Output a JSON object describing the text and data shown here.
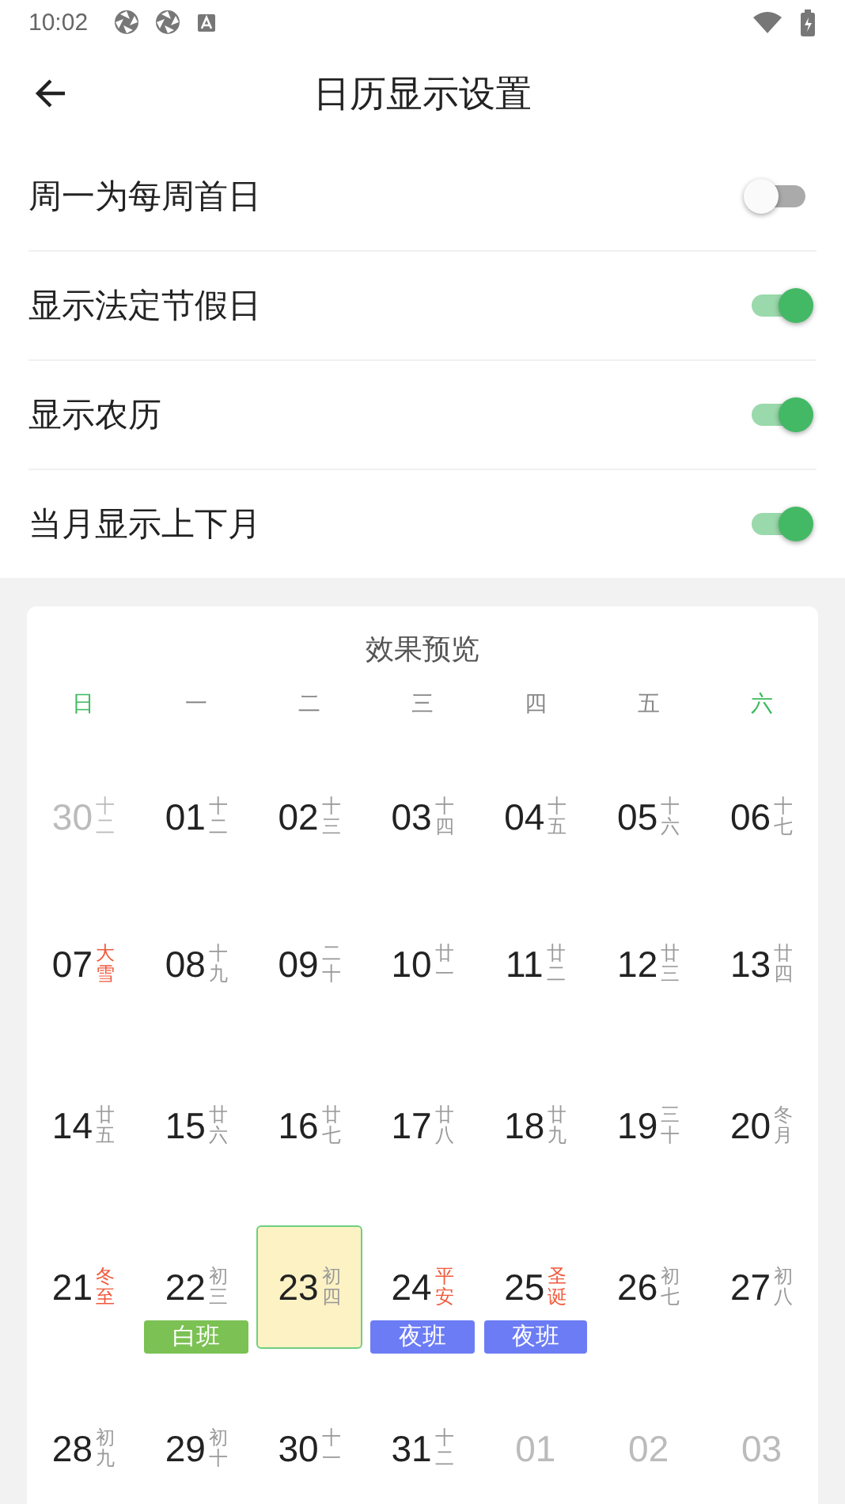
{
  "status_bar": {
    "time": "10:02"
  },
  "app_bar": {
    "title": "日历显示设置"
  },
  "settings": [
    {
      "label": "周一为每周首日",
      "on": false
    },
    {
      "label": "显示法定节假日",
      "on": true
    },
    {
      "label": "显示农历",
      "on": true
    },
    {
      "label": "当月显示上下月",
      "on": true
    }
  ],
  "preview": {
    "title": "效果预览",
    "weekdays": [
      {
        "label": "日",
        "weekend": true
      },
      {
        "label": "一",
        "weekend": false
      },
      {
        "label": "二",
        "weekend": false
      },
      {
        "label": "三",
        "weekend": false
      },
      {
        "label": "四",
        "weekend": false
      },
      {
        "label": "五",
        "weekend": false
      },
      {
        "label": "六",
        "weekend": true
      }
    ],
    "weeks": [
      [
        {
          "day": "30",
          "lunar": "十二",
          "other_month": true,
          "selected": false
        },
        {
          "day": "01",
          "lunar": "十二",
          "selected": false
        },
        {
          "day": "02",
          "lunar": "十三",
          "selected": false
        },
        {
          "day": "03",
          "lunar": "十四",
          "selected": false
        },
        {
          "day": "04",
          "lunar": "十五",
          "selected": false
        },
        {
          "day": "05",
          "lunar": "十六",
          "selected": false
        },
        {
          "day": "06",
          "lunar": "十七",
          "selected": false
        }
      ],
      [
        {
          "day": "07",
          "lunar": "大雪",
          "festival": true,
          "selected": false
        },
        {
          "day": "08",
          "lunar": "十九",
          "selected": false
        },
        {
          "day": "09",
          "lunar": "二十",
          "selected": false
        },
        {
          "day": "10",
          "lunar": "廿一",
          "selected": false
        },
        {
          "day": "11",
          "lunar": "廿二",
          "selected": false
        },
        {
          "day": "12",
          "lunar": "廿三",
          "selected": false
        },
        {
          "day": "13",
          "lunar": "廿四",
          "selected": false
        }
      ],
      [
        {
          "day": "14",
          "lunar": "廿五",
          "selected": false
        },
        {
          "day": "15",
          "lunar": "廿六",
          "selected": false
        },
        {
          "day": "16",
          "lunar": "廿七",
          "selected": false
        },
        {
          "day": "17",
          "lunar": "廿八",
          "selected": false
        },
        {
          "day": "18",
          "lunar": "廿九",
          "selected": false
        },
        {
          "day": "19",
          "lunar": "三十",
          "selected": false
        },
        {
          "day": "20",
          "lunar": "冬月",
          "selected": false
        }
      ],
      [
        {
          "day": "21",
          "lunar": "冬至",
          "festival": true,
          "selected": false
        },
        {
          "day": "22",
          "lunar": "初三",
          "selected": false,
          "tag": {
            "text": "白班",
            "color": "#7bc153"
          }
        },
        {
          "day": "23",
          "lunar": "初四",
          "selected": true
        },
        {
          "day": "24",
          "lunar": "平安",
          "festival": true,
          "selected": false,
          "tag": {
            "text": "夜班",
            "color": "#6c7cf5"
          }
        },
        {
          "day": "25",
          "lunar": "圣诞",
          "festival": true,
          "selected": false,
          "tag": {
            "text": "夜班",
            "color": "#6c7cf5"
          }
        },
        {
          "day": "26",
          "lunar": "初七",
          "selected": false
        },
        {
          "day": "27",
          "lunar": "初八",
          "selected": false
        }
      ],
      [
        {
          "day": "28",
          "lunar": "初九",
          "selected": false
        },
        {
          "day": "29",
          "lunar": "初十",
          "selected": false
        },
        {
          "day": "30",
          "lunar": "十一",
          "selected": false
        },
        {
          "day": "31",
          "lunar": "十二",
          "selected": false
        },
        {
          "day": "01",
          "other_month": true,
          "selected": false
        },
        {
          "day": "02",
          "other_month": true,
          "selected": false
        },
        {
          "day": "03",
          "other_month": true,
          "selected": false
        }
      ]
    ]
  }
}
